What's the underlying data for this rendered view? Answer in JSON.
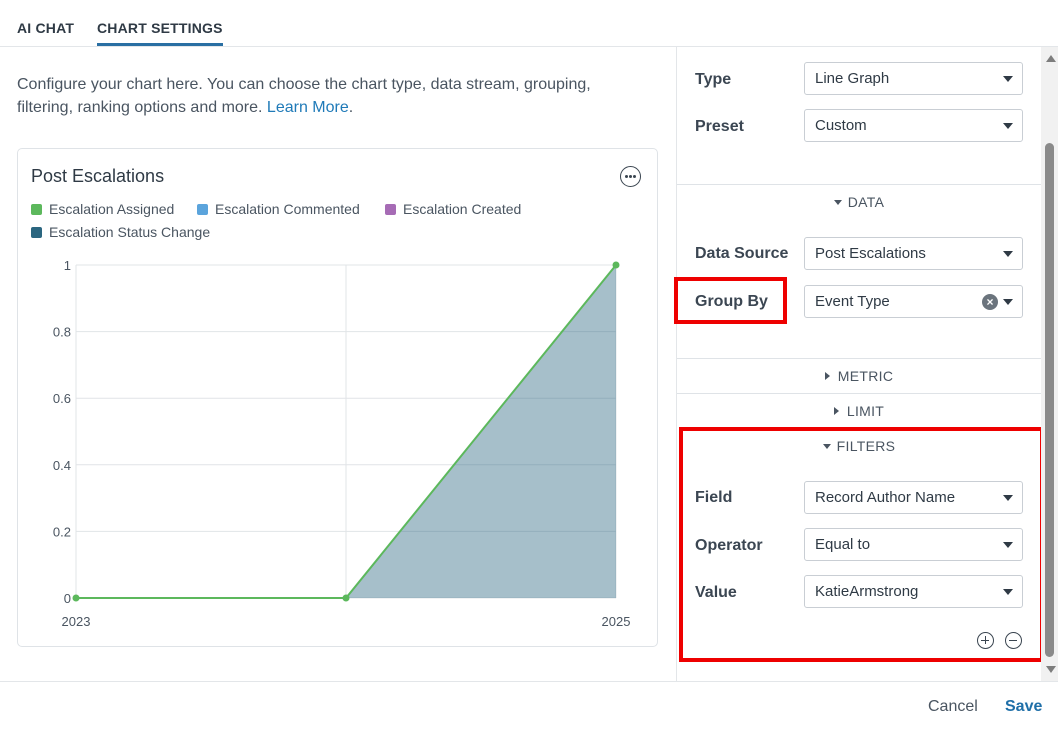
{
  "tabs": [
    {
      "label": "AI CHAT",
      "active": false
    },
    {
      "label": "CHART SETTINGS",
      "active": true
    }
  ],
  "intro": {
    "text": "Configure your chart here. You can choose the chart type, data stream, grouping, filtering, ranking options and more.",
    "link": "Learn More",
    "trailing": "."
  },
  "card": {
    "title": "Post Escalations",
    "more_icon": "ellipsis-circle-icon"
  },
  "chart_data": {
    "type": "area",
    "title": "Post Escalations",
    "legend": [
      {
        "name": "Escalation Assigned",
        "color": "#5cb85c"
      },
      {
        "name": "Escalation Commented",
        "color": "#5ba4dc"
      },
      {
        "name": "Escalation Created",
        "color": "#a66bb5"
      },
      {
        "name": "Escalation Status Change",
        "color": "#2b6680"
      }
    ],
    "x": [
      2023,
      2024,
      2025
    ],
    "x_tick_labels": [
      "2023",
      "2025"
    ],
    "y_tick_labels": [
      "0",
      "0.2",
      "0.4",
      "0.6",
      "0.8",
      "1"
    ],
    "ylim": [
      0,
      1
    ],
    "series": [
      {
        "name": "Escalation Status Change",
        "values": [
          0,
          0,
          1
        ],
        "color": "#2b6680",
        "fill_opacity": 0.42
      },
      {
        "name": "Escalation Assigned",
        "values": [
          0,
          0,
          1
        ],
        "color": "#5cb85c"
      }
    ],
    "grid": true,
    "legend_position": "top-left"
  },
  "settings": {
    "type": {
      "label": "Type",
      "value": "Line Graph"
    },
    "preset": {
      "label": "Preset",
      "value": "Custom"
    },
    "sections": {
      "data": "DATA",
      "metric": "METRIC",
      "limit": "LIMIT",
      "filters": "FILTERS"
    },
    "data_source": {
      "label": "Data Source",
      "value": "Post Escalations"
    },
    "group_by": {
      "label": "Group By",
      "value": "Event Type"
    },
    "field": {
      "label": "Field",
      "value": "Record Author Name"
    },
    "operator": {
      "label": "Operator",
      "value": "Equal to"
    },
    "value": {
      "label": "Value",
      "value": "KatieArmstrong"
    },
    "highlight_color": "#ee0000"
  },
  "footer": {
    "cancel": "Cancel",
    "save": "Save"
  }
}
